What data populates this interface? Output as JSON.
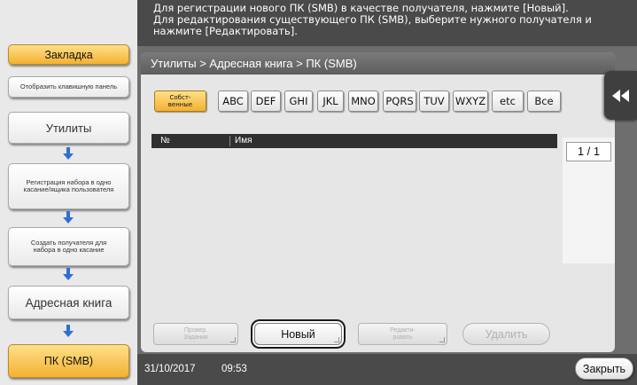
{
  "message": {
    "line1": "Для регистрации нового ПК (SMB) в качестве получателя, нажмите [Новый].",
    "line2": "Для редактирования существующего ПК (SMB), выберите нужного получателя и",
    "line3": "нажмите [Редактировать]."
  },
  "sidebar": {
    "bookmark": "Закладка",
    "keypad": "Отобразить клавишную панель",
    "utilities": "Утилиты",
    "register_one_touch": "Регистрация набора в одно касание/ящика пользователя",
    "create_one_touch": "Создать получателя для набора в одно касание",
    "address_book": "Адресная книга",
    "pc_smb": "ПК (SMB)"
  },
  "breadcrumb": "Утилиты > Адресная книга > ПК (SMB)",
  "index_tabs": {
    "own": "Собст-\nвенные",
    "abc": "ABC",
    "def": "DEF",
    "ghi": "GHI",
    "jkl": "JKL",
    "mno": "MNO",
    "pqrs": "PQRS",
    "tuv": "TUV",
    "wxyz": "WXYZ",
    "etc": "etc",
    "all": "Все"
  },
  "list": {
    "col_number": "№",
    "col_name": "Имя"
  },
  "pager": "1 / 1",
  "buttons": {
    "check_job": "Провер.\nЗадания",
    "new": "Новый",
    "edit": "Редакти-\nровать",
    "delete": "Удалить",
    "close": "Закрыть"
  },
  "status": {
    "date": "31/10/2017",
    "time": "09:53"
  },
  "colors": {
    "accent_orange": "#f3b132",
    "arrow_blue": "#2f6fd6",
    "panel_dark": "#6e6e6e"
  },
  "icons": {
    "down_arrow": "down-arrow-icon",
    "collapse": "double-chevron-left-icon"
  }
}
